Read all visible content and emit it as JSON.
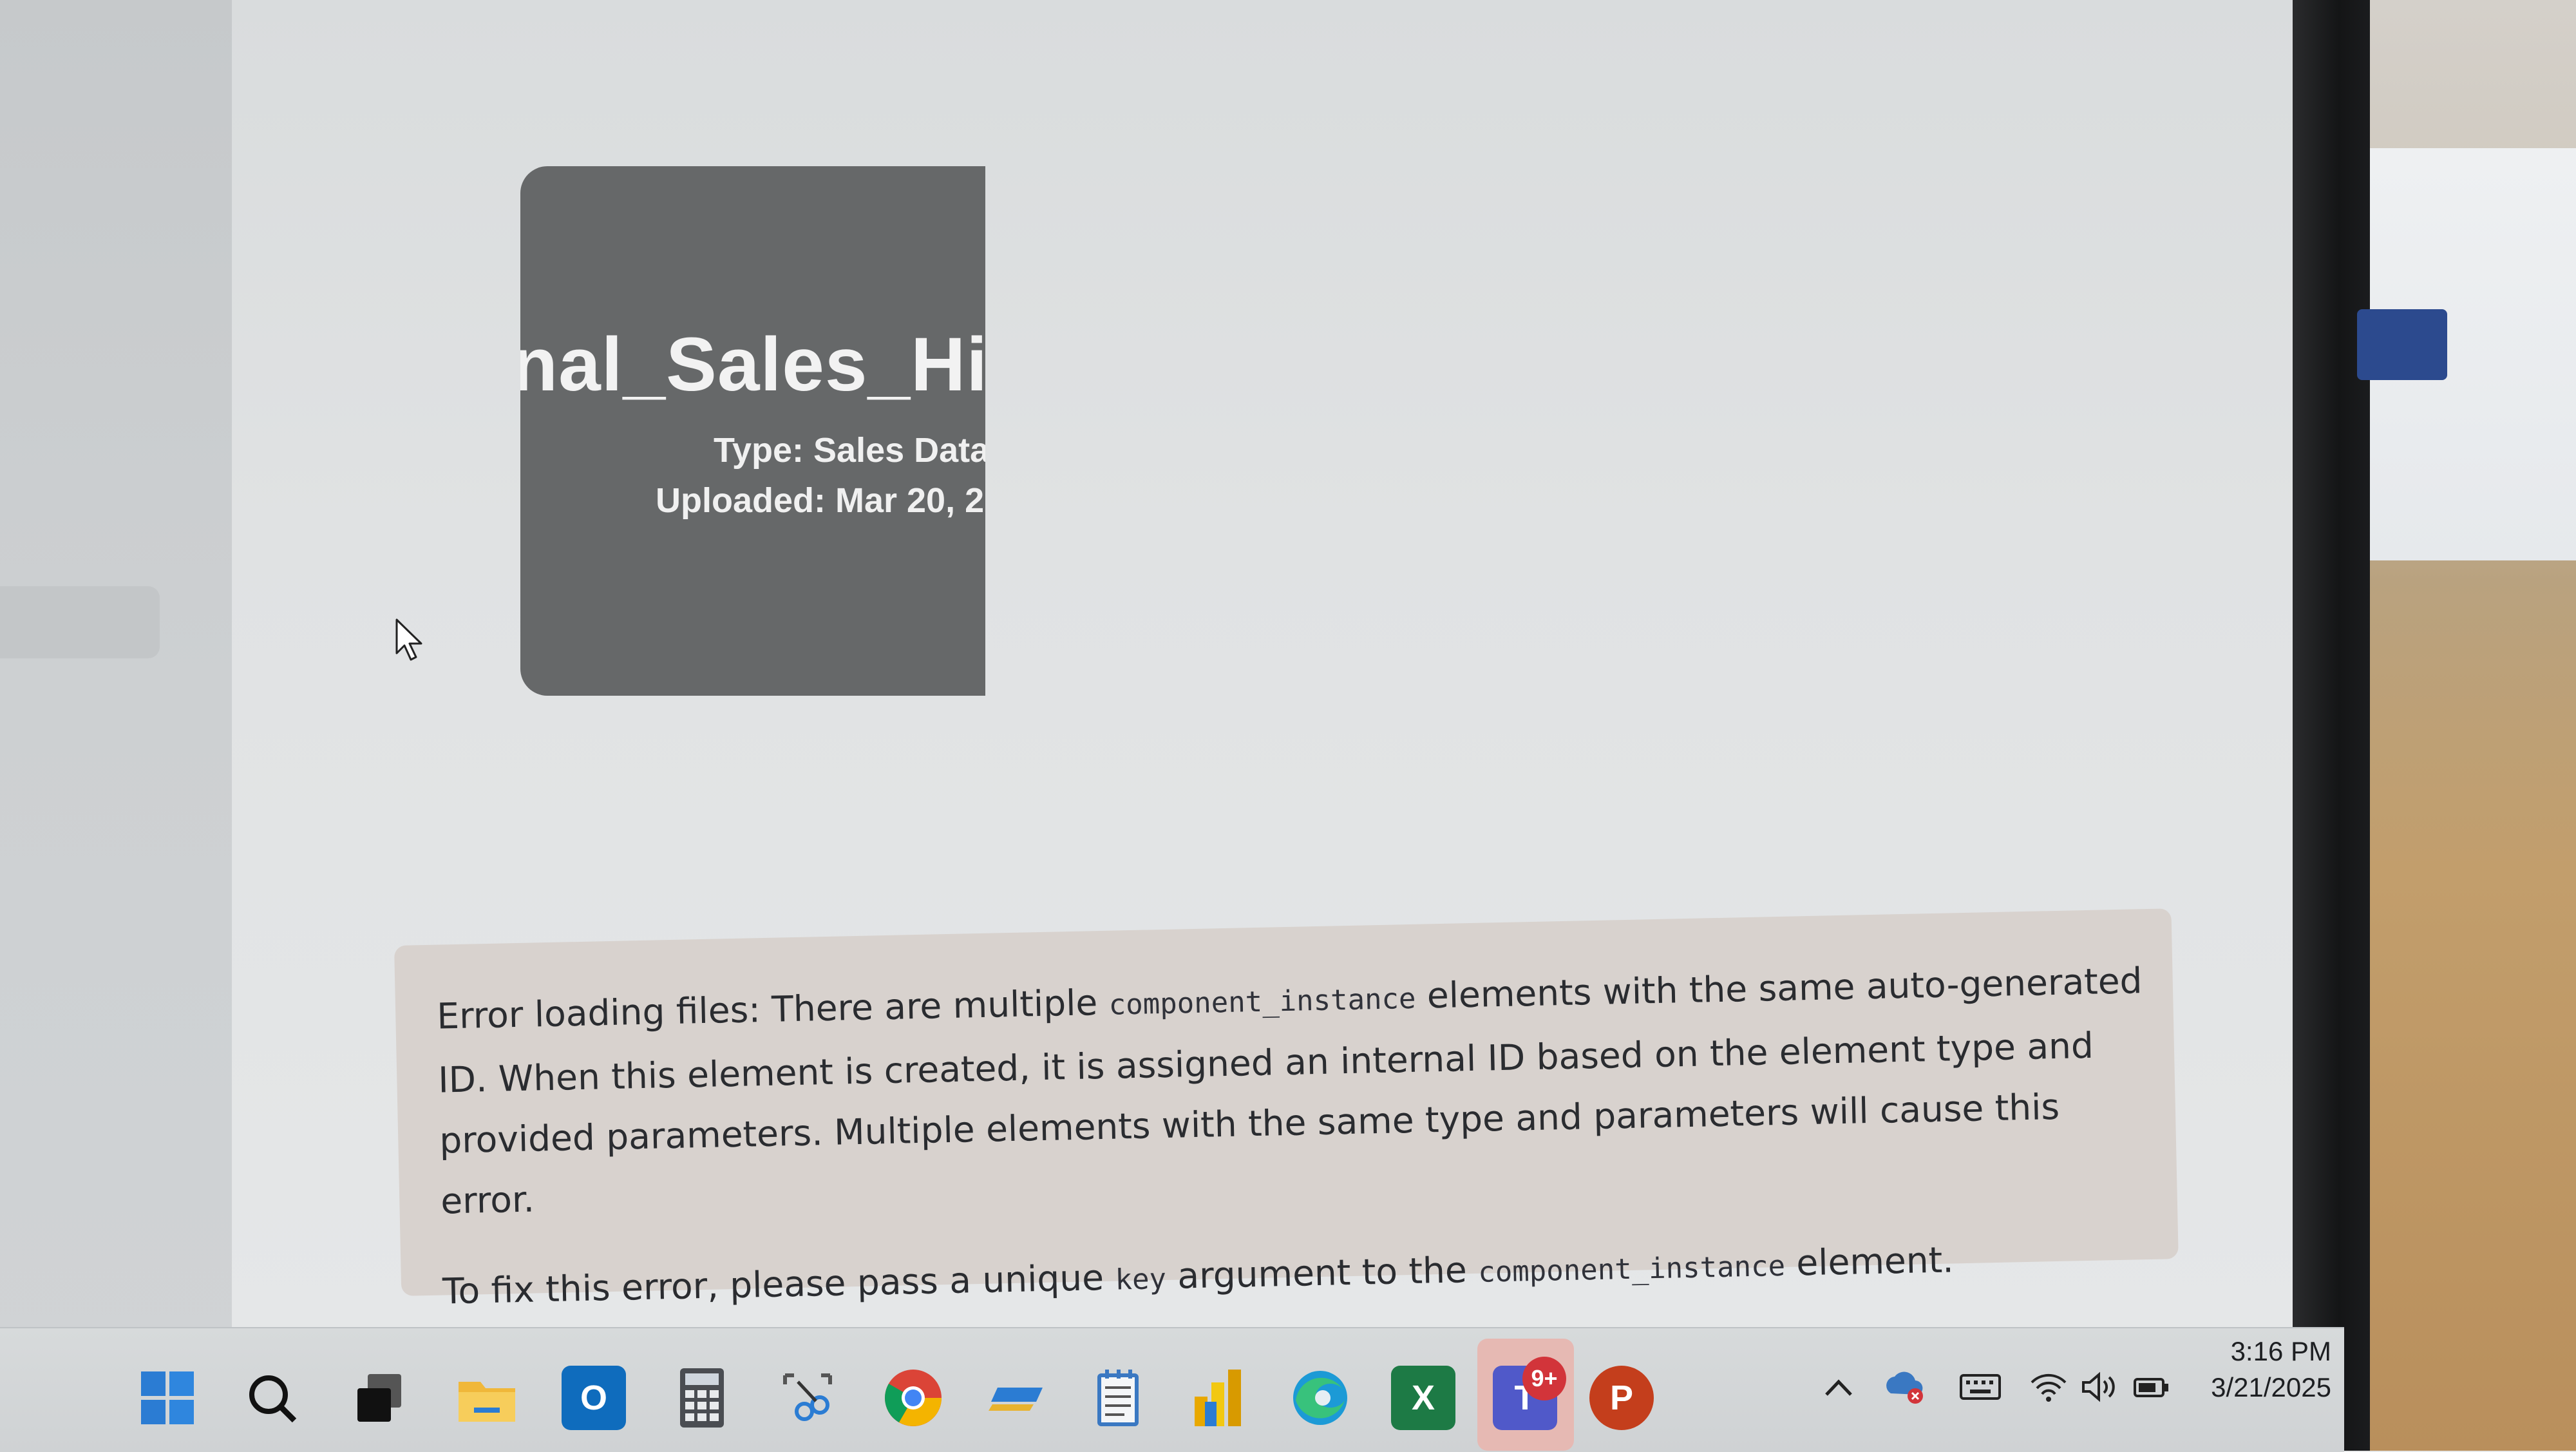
{
  "file_card": {
    "name": "nal_Sales_Hist",
    "type_line": "Type: Sales Data",
    "uploaded_line": "Uploaded: Mar 20, 2"
  },
  "error": {
    "p1_a": "Error loading files: There are multiple ",
    "p1_code": "component_instance",
    "p1_b": " elements with the same auto-generated ID. When this element is created, it is assigned an internal ID based on the element type and provided parameters. Multiple elements with the same type and parameters will cause this error.",
    "p2_a": "To fix this error, please pass a unique ",
    "p2_code1": "key",
    "p2_b": " argument to the ",
    "p2_code2": "component_instance",
    "p2_c": " element."
  },
  "taskbar": {
    "icons": [
      "windows-start-icon",
      "search-icon",
      "task-view-icon",
      "file-explorer-icon",
      "outlook-icon",
      "calculator-icon",
      "snipping-tool-icon",
      "chrome-icon",
      "sticky-icon",
      "notepad-icon",
      "power-bi-icon",
      "edge-icon",
      "excel-icon",
      "teams-icon",
      "powerpoint-icon"
    ],
    "teams_badge": "9+",
    "outlook_letter": "O",
    "excel_letter": "X",
    "teams_letter": "T",
    "powerpoint_letter": "P"
  },
  "tray": {
    "icons": [
      "chevron-up-icon",
      "onedrive-error-icon",
      "keyboard-icon",
      "wifi-icon",
      "volume-icon",
      "battery-icon"
    ]
  },
  "clock": {
    "time": "3:16 PM",
    "date": "3/21/2025"
  },
  "colors": {
    "card_bg": "#666869",
    "error_bg": "#d8d2ce",
    "badge": "#d2343a"
  }
}
